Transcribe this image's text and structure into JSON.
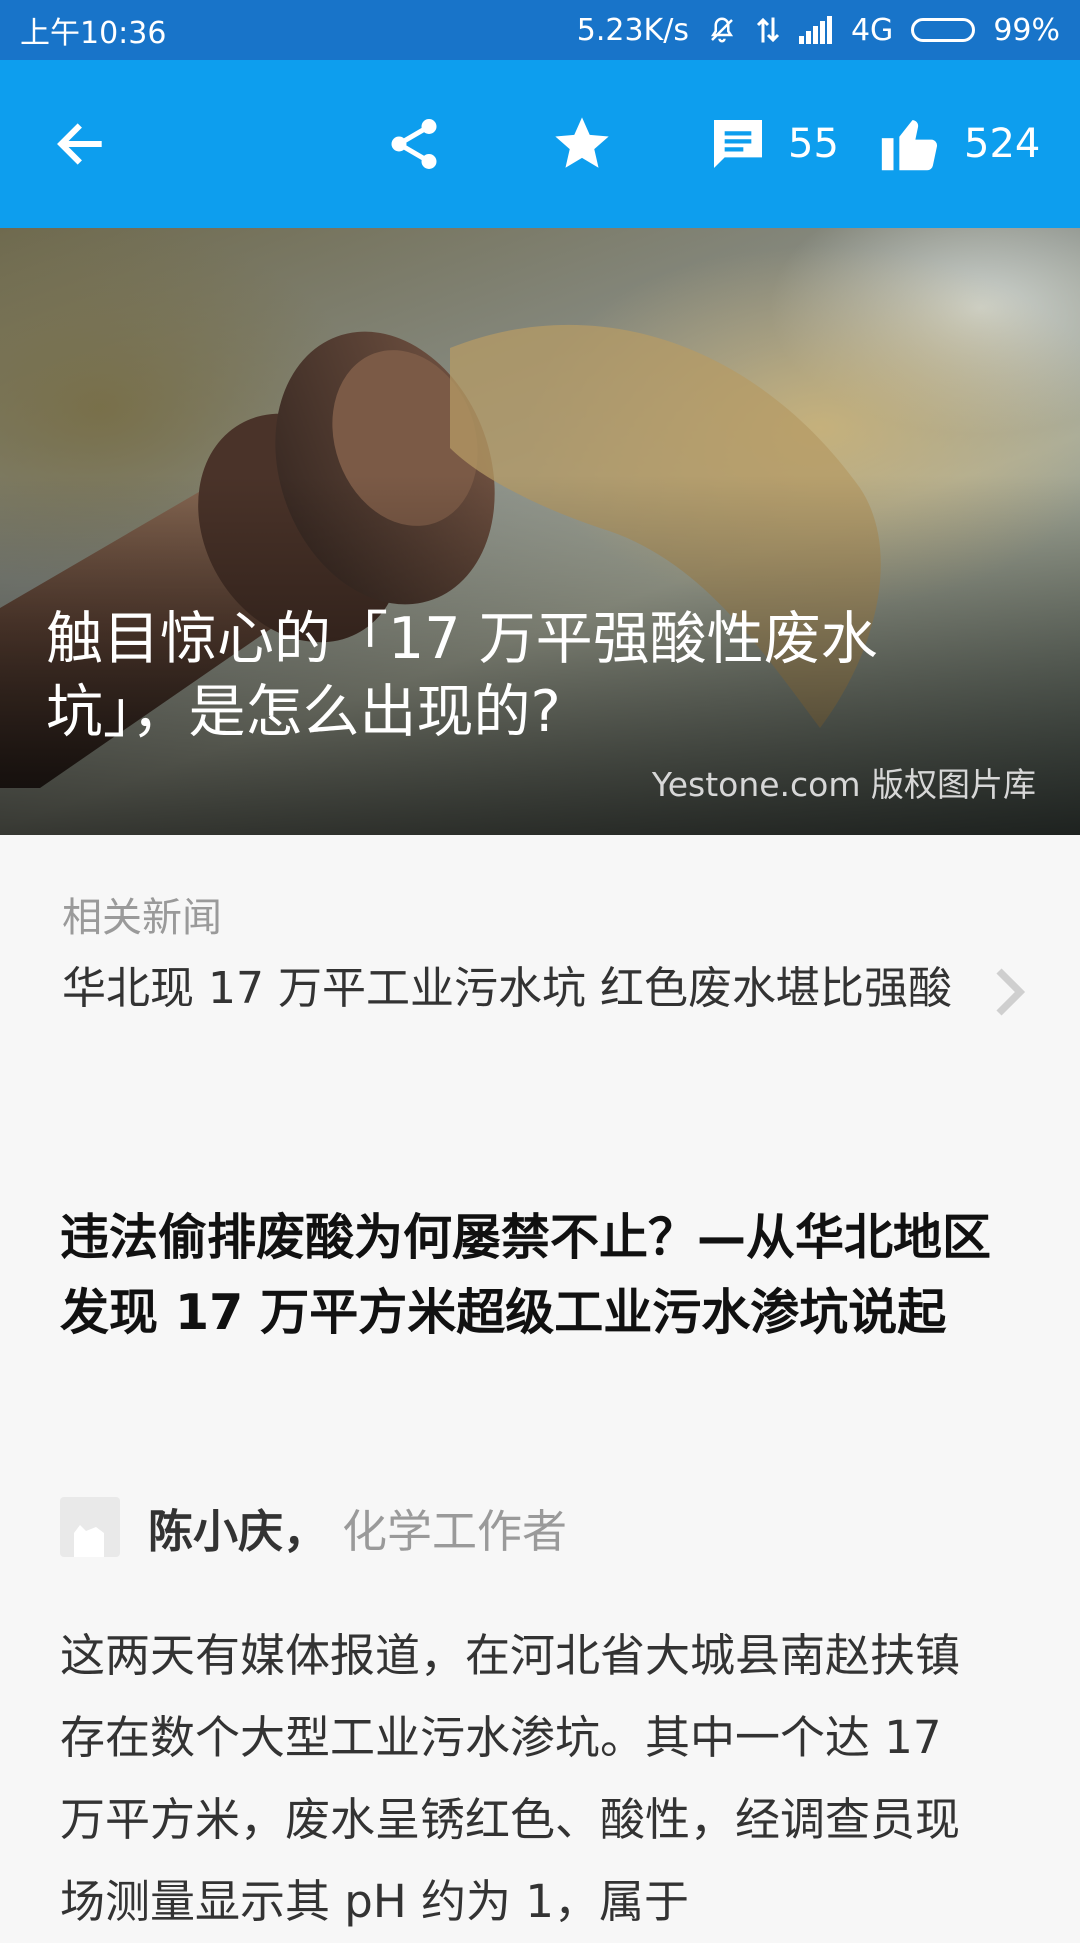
{
  "status_bar": {
    "time": "上午10:36",
    "network_speed": "5.23K/s",
    "network_type": "4G",
    "battery_text": "99%",
    "battery_level": 0.99,
    "icons": [
      "mute-icon",
      "data-transfer-icon",
      "signal-icon",
      "battery-icon"
    ]
  },
  "toolbar": {
    "icons": [
      "back-arrow-icon",
      "share-icon",
      "star-icon",
      "comment-icon",
      "thumbs-up-icon"
    ],
    "comment_count": "55",
    "like_count": "524"
  },
  "hero": {
    "title": "触目惊心的「17 万平强酸性废水坑」，是怎么出现的?",
    "credit": "Yestone.com 版权图片库"
  },
  "related": {
    "label": "相关新闻",
    "link_text": "华北现 17 万平工业污水坑 红色废水堪比强酸"
  },
  "article": {
    "title": "违法偷排废酸为何屡禁不止？—从华北地区发现 17 万平方米超级工业污水渗坑说起",
    "author_name": "陈小庆，",
    "author_role": "化学工作者",
    "body": "这两天有媒体报道，在河北省大城县南赵扶镇存在数个大型工业污水渗坑。其中一个达 17 万平方米，废水呈锈红色、酸性，经调查员现场测量显示其 pH 约为 1，属于"
  },
  "colors": {
    "status_bar_bg": "#1874c9",
    "toolbar_bg": "#0d9eee",
    "page_bg": "#f7f7f7"
  }
}
